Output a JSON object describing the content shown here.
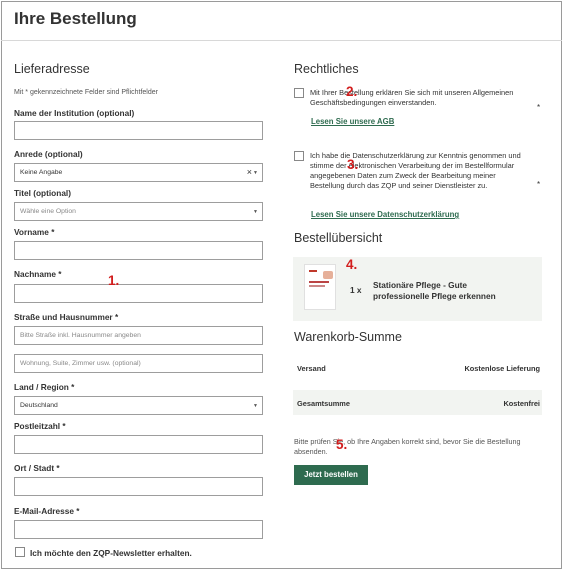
{
  "page_title": "Ihre Bestellung",
  "delivery": {
    "heading": "Lieferadresse",
    "required_note": "Mit * gekennzeichnete Felder sind Pflichtfelder",
    "institution_label": "Name der Institution (optional)",
    "salutation_label": "Anrede (optional)",
    "salutation_value": "Keine Angabe",
    "title_label": "Titel (optional)",
    "title_placeholder": "Wähle eine Option",
    "first_name_label": "Vorname",
    "last_name_label": "Nachname",
    "street_label": "Straße und Hausnummer",
    "street_placeholder": "Bitte Straße inkl. Hausnummer angeben",
    "address2_placeholder": "Wohnung, Suite, Zimmer usw. (optional)",
    "country_label": "Land / Region",
    "country_value": "Deutschland",
    "zip_label": "Postleitzahl",
    "city_label": "Ort / Stadt",
    "email_label": "E-Mail-Adresse",
    "newsletter_label": "Ich möchte den ZQP-Newsletter erhalten.",
    "required_mark": "*"
  },
  "legal": {
    "heading": "Rechtliches",
    "terms_text": "Mit Ihrer Bestellung erklären Sie sich mit unseren Allgemeinen Geschäftsbedingungen einverstanden.",
    "terms_link": "Lesen Sie unsere AGB",
    "privacy_text": "Ich habe die Datenschutzerklärung zur Kenntnis genommen und stimme der elektronischen Verarbeitung der im Bestellformular angegebenen Daten zum Zweck der Bearbeitung meiner Bestellung durch das ZQP und seiner Dienstleister zu.",
    "privacy_link": "Lesen Sie unsere Datenschutzerklärung",
    "required_mark": "*"
  },
  "order": {
    "heading": "Bestellübersicht",
    "quantity": "1 x",
    "product_name": "Stationäre Pflege - Gute professionelle Pflege erkennen"
  },
  "cart": {
    "heading": "Warenkorb-Summe",
    "shipping_label": "Versand",
    "shipping_value": "Kostenlose Lieferung",
    "total_label": "Gesamtsumme",
    "total_value": "Kostenfrei"
  },
  "footer": {
    "check_note": "Bitte prüfen Sie, ob Ihre Angaben korrekt sind, bevor Sie die Bestellung absenden.",
    "submit_label": "Jetzt bestellen"
  },
  "markers": {
    "m1": "1.",
    "m2": "2.",
    "m3": "3.",
    "m4": "4.",
    "m5": "5."
  },
  "colors": {
    "accent": "#2e6b4f",
    "marker": "#d21e1e",
    "panel": "#f2f4f1"
  }
}
